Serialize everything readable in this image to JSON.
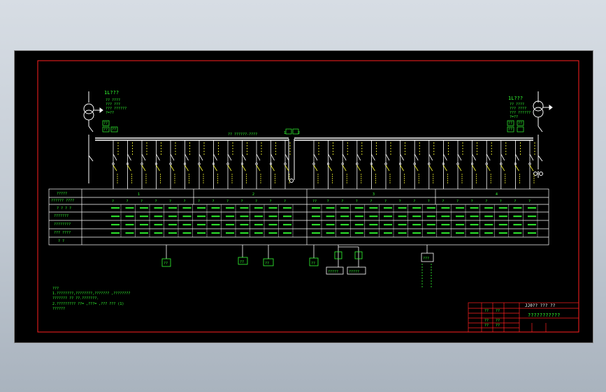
{
  "colors": {
    "background": "#000000",
    "frame_border": "#ff2020",
    "linework": "#ffffff",
    "text": "#33ff33",
    "switchgear": "#ffff33"
  },
  "left_transformer": {
    "label": "1L???",
    "spec_lines": [
      "?? ????",
      "??? ???",
      "??? ??????",
      "?=??"
    ],
    "meters": [
      "??",
      "??",
      "??"
    ]
  },
  "right_transformer": {
    "label": "1L???",
    "spec_lines": [
      "?? ????",
      "??? ????",
      "??? ??????",
      "?=??"
    ],
    "meters": [
      "??",
      "??",
      "??"
    ]
  },
  "busbar": {
    "label": "?? ??????-????",
    "tie_labels": [
      "1",
      "2"
    ]
  },
  "table": {
    "sections": [
      "1",
      "2",
      "3",
      "4"
    ],
    "row_headers": [
      "?????",
      "?????? ????",
      "? ? ? ?",
      "???????",
      "????????",
      "??? ????",
      "? ?"
    ],
    "panel_codes": [
      "?",
      "?",
      "?",
      "?",
      "?",
      "?",
      "?",
      "?",
      "?",
      "?",
      "?",
      "?",
      "?",
      "??",
      "?",
      "?",
      "?",
      "?",
      "?",
      "?",
      "?",
      "?",
      "?",
      "?",
      "?",
      "?",
      "?",
      "?",
      "?"
    ]
  },
  "bottom_labels": [
    "??",
    "??",
    "??",
    "??",
    "?????",
    "?????",
    "???"
  ],
  "notes": [
    "???",
    "1.????????,????????,???????         ,????????",
    "  ??????? ??          ??.???????.",
    "2.?????????   ??=  ,???=   ,??? ???     (1)",
    "  ??????"
  ],
  "title_block": {
    "title": "JJ0??     ???   ??",
    "name": "???????????",
    "small": [
      "??",
      "??",
      "??",
      "??",
      "??",
      "??"
    ]
  }
}
